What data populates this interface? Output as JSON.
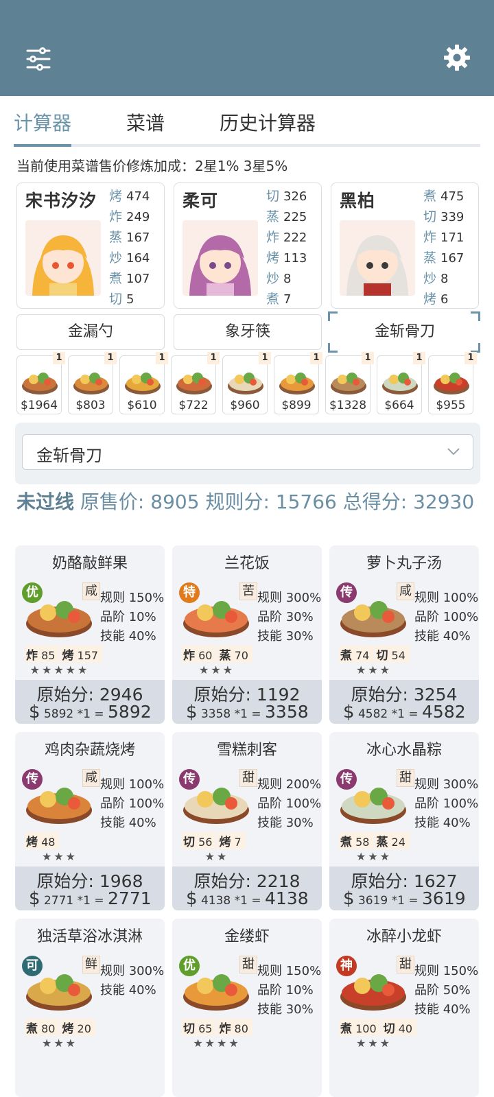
{
  "tabs": [
    "计算器",
    "菜谱",
    "历史计算器"
  ],
  "bonus_text": "当前使用菜谱售价修炼加成：2星1% 3星5%",
  "chefs": [
    {
      "name": "宋书汐汐",
      "skills": [
        [
          "烤",
          "474"
        ],
        [
          "炸",
          "249"
        ],
        [
          "蒸",
          "167"
        ],
        [
          "炒",
          "164"
        ],
        [
          "煮",
          "107"
        ],
        [
          "切",
          "5"
        ]
      ]
    },
    {
      "name": "柔可",
      "skills": [
        [
          "切",
          "326"
        ],
        [
          "蒸",
          "225"
        ],
        [
          "炸",
          "222"
        ],
        [
          "烤",
          "113"
        ],
        [
          "炒",
          "8"
        ],
        [
          "煮",
          "7"
        ]
      ]
    },
    {
      "name": "黑柏",
      "skills": [
        [
          "煮",
          "475"
        ],
        [
          "切",
          "339"
        ],
        [
          "炸",
          "171"
        ],
        [
          "蒸",
          "167"
        ],
        [
          "炒",
          "8"
        ],
        [
          "烤",
          "6"
        ]
      ]
    }
  ],
  "equips": [
    "金漏勺",
    "象牙筷",
    "金斩骨刀"
  ],
  "dish_thumbs": [
    {
      "price": "$1964",
      "qty": "1"
    },
    {
      "price": "$803",
      "qty": "1"
    },
    {
      "price": "$610",
      "qty": "1"
    },
    {
      "price": "$722",
      "qty": "1"
    },
    {
      "price": "$960",
      "qty": "1"
    },
    {
      "price": "$899",
      "qty": "1"
    },
    {
      "price": "$1328",
      "qty": "1"
    },
    {
      "price": "$664",
      "qty": "1"
    },
    {
      "price": "$955",
      "qty": "1"
    }
  ],
  "selected_equip": "金斩骨刀",
  "result": {
    "status": "未过线",
    "label1": "原售价:",
    "v1": "8905",
    "label2": "规则分:",
    "v2": "15766",
    "label3": "总得分:",
    "v3": "32930"
  },
  "cards": [
    {
      "title": "奶酪敲鲜果",
      "rank": "优",
      "rank_color": "#5f9e2a",
      "taste": "咸",
      "stats": [
        "规则 150%",
        "品阶 10%",
        "技能 40%"
      ],
      "need": [
        [
          "炸",
          "85"
        ],
        [
          "烤",
          "157"
        ]
      ],
      "stars": "★★★★★",
      "orig": "原始分: 2946",
      "price": "5892",
      "mult": "*1",
      "total": "5892"
    },
    {
      "title": "兰花饭",
      "rank": "特",
      "rank_color": "#e07a1a",
      "taste": "苦",
      "stats": [
        "规则 300%",
        "品阶 30%",
        "技能 30%"
      ],
      "need": [
        [
          "炸",
          "60"
        ],
        [
          "蒸",
          "70"
        ]
      ],
      "stars": "★★★",
      "orig": "原始分: 1192",
      "price": "3358",
      "mult": "*1",
      "total": "3358"
    },
    {
      "title": "萝卜丸子汤",
      "rank": "传",
      "rank_color": "#8a3a6e",
      "taste": "咸",
      "stats": [
        "规则 100%",
        "品阶 100%",
        "技能 40%"
      ],
      "need": [
        [
          "煮",
          "74"
        ],
        [
          "切",
          "54"
        ]
      ],
      "stars": "★★★",
      "orig": "原始分: 3254",
      "price": "4582",
      "mult": "*1",
      "total": "4582"
    },
    {
      "title": "鸡肉杂蔬烧烤",
      "rank": "传",
      "rank_color": "#8a3a6e",
      "taste": "咸",
      "stats": [
        "规则 100%",
        "品阶 100%",
        "技能 40%"
      ],
      "need": [
        [
          "烤",
          "48"
        ]
      ],
      "stars": "★★★",
      "orig": "原始分: 1968",
      "price": "2771",
      "mult": "*1",
      "total": "2771"
    },
    {
      "title": "雪糕刺客",
      "rank": "传",
      "rank_color": "#8a3a6e",
      "taste": "甜",
      "stats": [
        "规则 200%",
        "品阶 100%",
        "技能 30%"
      ],
      "need": [
        [
          "切",
          "56"
        ],
        [
          "烤",
          "7"
        ]
      ],
      "stars": "★★",
      "orig": "原始分: 2218",
      "price": "4138",
      "mult": "*1",
      "total": "4138"
    },
    {
      "title": "冰心水晶粽",
      "rank": "传",
      "rank_color": "#8a3a6e",
      "taste": "甜",
      "stats": [
        "规则 300%",
        "品阶 100%",
        "技能 40%"
      ],
      "need": [
        [
          "煮",
          "58"
        ],
        [
          "蒸",
          "24"
        ]
      ],
      "stars": "★★★",
      "orig": "原始分: 1627",
      "price": "3619",
      "mult": "*1",
      "total": "3619"
    },
    {
      "title": "独活草浴冰淇淋",
      "rank": "可",
      "rank_color": "#2f6b73",
      "taste": "鲜",
      "stats": [
        "规则 300%",
        "技能 40%"
      ],
      "need": [
        [
          "煮",
          "80"
        ],
        [
          "烤",
          "20"
        ]
      ],
      "stars": "★★★",
      "orig": "",
      "price": "",
      "mult": "",
      "total": ""
    },
    {
      "title": "金缕虾",
      "rank": "优",
      "rank_color": "#5f9e2a",
      "taste": "甜",
      "stats": [
        "规则 150%",
        "品阶 10%",
        "技能 30%"
      ],
      "need": [
        [
          "切",
          "65"
        ],
        [
          "炸",
          "80"
        ]
      ],
      "stars": "★★★★",
      "orig": "",
      "price": "",
      "mult": "",
      "total": ""
    },
    {
      "title": "冰醉小龙虾",
      "rank": "神",
      "rank_color": "#c23a22",
      "taste": "甜",
      "stats": [
        "规则 150%",
        "品阶 50%",
        "技能 40%"
      ],
      "need": [
        [
          "煮",
          "100"
        ],
        [
          "切",
          "40"
        ]
      ],
      "stars": "★★★",
      "orig": "",
      "price": "",
      "mult": "",
      "total": ""
    }
  ]
}
